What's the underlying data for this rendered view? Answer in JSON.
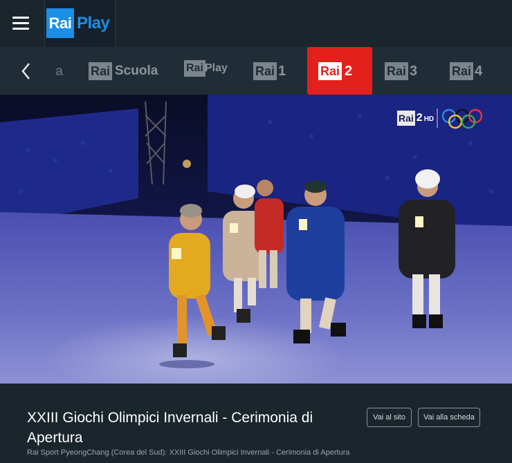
{
  "header": {
    "logo_box": "Rai",
    "logo_text": "Play"
  },
  "channels": {
    "items": [
      {
        "badge": "Rai",
        "suffix": "Scuola"
      },
      {
        "badge": "Rai",
        "suffix": "Play"
      },
      {
        "badge": "Rai",
        "suffix": "1"
      },
      {
        "badge": "Rai",
        "suffix": "2",
        "active": true
      },
      {
        "badge": "Rai",
        "suffix": "3"
      },
      {
        "badge": "Rai",
        "suffix": "4"
      }
    ],
    "partial_text": "a"
  },
  "player": {
    "channel_bug_badge": "Rai",
    "channel_bug_num": "2",
    "channel_bug_hd": "HD"
  },
  "program": {
    "title": "XXIII Giochi Olimpici Invernali - Cerimonia di Apertura",
    "subtitle": "Rai Sport PyeongChang (Corea del Sud): XXIII Giochi Olimpici Invernali - Cerimonia di Apertura",
    "site_button": "Vai al sito",
    "detail_button": "Vai alla scheda"
  },
  "colors": {
    "accent_blue": "#1b8fe6",
    "active_channel": "#e2211c",
    "background": "#1b252c"
  }
}
